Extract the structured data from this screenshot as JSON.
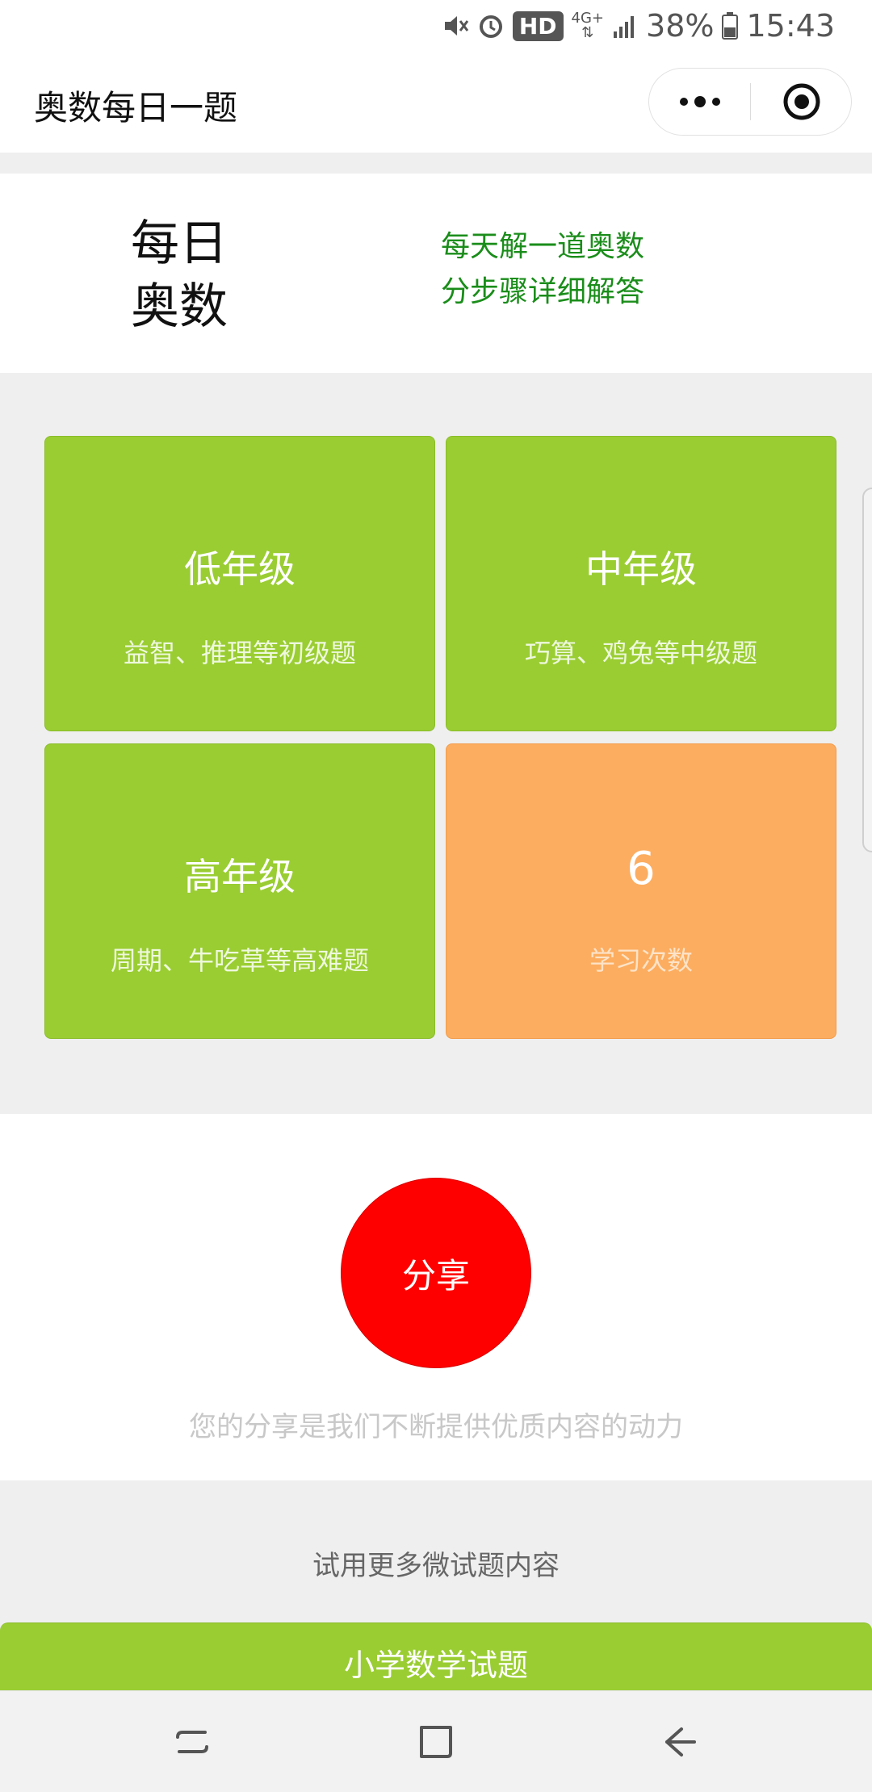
{
  "status_bar": {
    "hd_label": "HD",
    "network_label": "4G+",
    "battery": "38%",
    "time": "15:43",
    "icons": [
      "mute-icon",
      "alarm-icon",
      "signal-icon",
      "battery-icon"
    ]
  },
  "header": {
    "title": "奥数每日一题",
    "capsule_icons": [
      "more-dots-icon",
      "target-icon"
    ]
  },
  "hero": {
    "brand_line1": "每日",
    "brand_line2": "奥数",
    "slogan_line1": "每天解一道奥数",
    "slogan_line2": "分步骤详细解答",
    "slogan_color": "#1a8d1a"
  },
  "tiles": [
    {
      "title": "低年级",
      "subtitle": "益智、推理等初级题"
    },
    {
      "title": "中年级",
      "subtitle": "巧算、鸡兔等中级题"
    },
    {
      "title": "高年级",
      "subtitle": "周期、牛吃草等高难题"
    },
    {
      "title": "6",
      "subtitle": "学习次数"
    }
  ],
  "colors": {
    "tile_green": "#9acd32",
    "tile_orange": "#fcad60",
    "share_red": "#ff0000"
  },
  "share": {
    "button_label": "分享",
    "note": "您的分享是我们不断提供优质内容的动力"
  },
  "more": {
    "heading": "试用更多微试题内容",
    "button_label": "小学数学试题"
  },
  "nav_bar": {
    "icons": [
      "recent-apps-icon",
      "home-icon",
      "back-icon"
    ]
  }
}
